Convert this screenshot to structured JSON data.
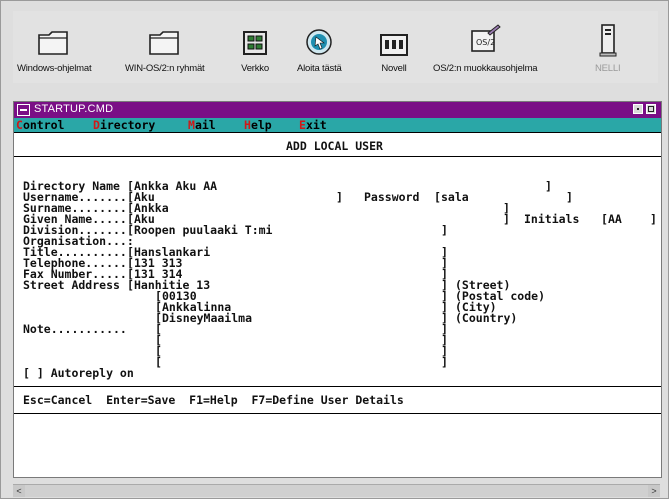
{
  "desktop": {
    "icons": [
      {
        "label": "Windows-ohjelmat",
        "icon": "folder-icon"
      },
      {
        "label": "WIN-OS/2:n ryhmät",
        "icon": "folder-icon"
      },
      {
        "label": "Verkko",
        "icon": "network-icon"
      },
      {
        "label": "Aloita tästä",
        "icon": "start-here-icon"
      },
      {
        "label": "Novell",
        "icon": "novell-icon"
      },
      {
        "label": "OS/2:n muokkausohjelma",
        "icon": "editor-icon"
      },
      {
        "label": "NELLI",
        "icon": "tower-computer-icon"
      }
    ]
  },
  "window": {
    "title": "STARTUP.CMD",
    "menu": [
      {
        "hotkey": "C",
        "rest": "ontrol"
      },
      {
        "hotkey": "D",
        "rest": "irectory"
      },
      {
        "hotkey": "M",
        "rest": "ail"
      },
      {
        "hotkey": "H",
        "rest": "elp"
      },
      {
        "hotkey": "E",
        "rest": "xit",
        "prefix": ""
      }
    ]
  },
  "form": {
    "title": "ADD LOCAL USER",
    "directory_name_label": "Directory Name",
    "directory_name": "Ankka Aku AA",
    "username_label": "Username.......",
    "username": "Aku",
    "password_label": "Password",
    "password": "sala",
    "surname_label": "Surname........",
    "surname": "Ankka",
    "given_name_label": "Given Name.....",
    "given_name": "Aku",
    "initials_label": "Initials",
    "initials": "AA",
    "division_label": "Division.......",
    "division": "Roopen puulaaki T:mi",
    "organisation_label": "Organisation...:",
    "title_label": "Title..........",
    "title_value": "Hanslankari",
    "telephone_label": "Telephone......",
    "telephone": "131 313",
    "fax_label": "Fax Number.....",
    "fax": "131 314",
    "street_label": "Street Address",
    "street": "Hanhitie 13",
    "postal_code": "00130",
    "city": "Ankkalinna",
    "country": "DisneyMaailma",
    "street_hint": "(Street)",
    "postal_hint": "(Postal code)",
    "city_hint": "(City)",
    "country_hint": "(Country)",
    "note_label": "Note...........",
    "autoreply": "[ ] Autoreply on",
    "footer": "Esc=Cancel  Enter=Save  F1=Help  F7=Define User Details"
  },
  "colors": {
    "titlebar": "#7a0f86",
    "menubar": "#2aa7a7",
    "hotkey": "#d11818"
  }
}
